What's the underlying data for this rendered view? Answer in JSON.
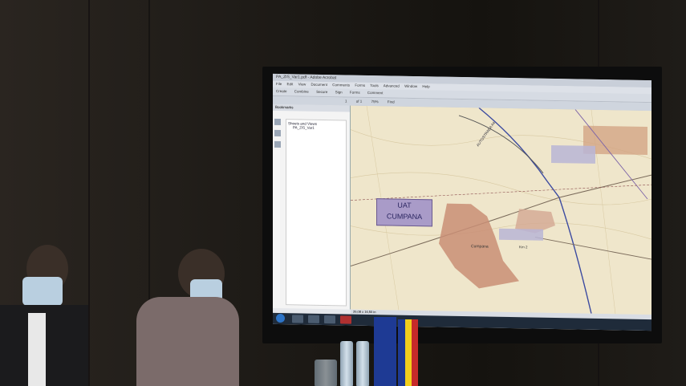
{
  "window": {
    "title": "PA_ZIS_Var1.pdf - Adobe Acrobat"
  },
  "menu": [
    "File",
    "Edit",
    "View",
    "Document",
    "Comments",
    "Forms",
    "Tools",
    "Advanced",
    "Window",
    "Help"
  ],
  "toolbar": {
    "create_label": "Create",
    "combine_label": "Combine",
    "secure_label": "Secure",
    "sign_label": "Sign",
    "forms_label": "Forms",
    "comment_label": "Comment"
  },
  "navigation": {
    "page_field": "1",
    "page_total": "of 1",
    "zoom": "75%",
    "find_placeholder": "Find"
  },
  "sidebar": {
    "header": "Bookmarks",
    "tree_root": "Sheets and Views",
    "tree_child": "PA_ZIS_Var1"
  },
  "map": {
    "uat_line1": "UAT",
    "uat_line2": "CUMPANA",
    "town": "Cumpana",
    "road_label": "Km 2",
    "highway": "AUTOSTRADA A4"
  },
  "statusbar": {
    "dimensions": "26,08 x 16,50 in"
  }
}
